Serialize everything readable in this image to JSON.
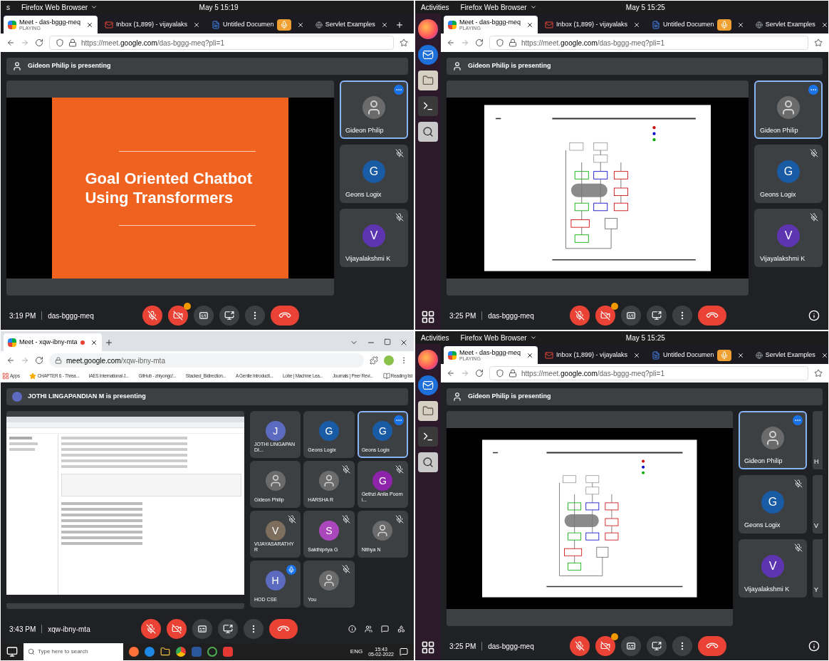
{
  "panels": [
    {
      "kind": "firefox",
      "topbar": {
        "activities": "s",
        "app": "Firefox Web Browser",
        "clock": "May 5  15:19"
      },
      "tabs": [
        {
          "title": "Meet - das-bggg-meq",
          "subtitle": "PLAYING",
          "kind": "meet",
          "sharing": false,
          "selected": true
        },
        {
          "title": "Inbox (1,899) - vijayalaks",
          "kind": "mail",
          "sharing": false,
          "selected": false
        },
        {
          "title": "Untitled Documen",
          "kind": "doc",
          "sharing": true,
          "selected": false
        },
        {
          "title": "Servlet Examples",
          "kind": "page",
          "sharing": false,
          "selected": false
        }
      ],
      "url": {
        "prefix": "https://meet.",
        "domain": "google.com",
        "path": "/das-bggg-meq?pli=1"
      },
      "banner": {
        "text": "Gideon Philip is presenting",
        "kind": "presenter"
      },
      "stage": {
        "kind": "title",
        "lines": [
          "Goal Oriented Chatbot",
          "Using Transformers"
        ]
      },
      "tiles": [
        {
          "name": "Gideon Philip",
          "kind": "photo",
          "selected": true,
          "muted": false,
          "speaking": false
        },
        {
          "name": "Geons Logix",
          "kind": "letter",
          "initial": "G",
          "color": "#1a5ba6",
          "selected": false,
          "muted": true,
          "speaking": false
        },
        {
          "name": "Vijayalakshmi K",
          "kind": "letter",
          "initial": "V",
          "color": "#5e35b1",
          "selected": false,
          "muted": true,
          "speaking": false
        }
      ],
      "bottom": {
        "time": "3:19 PM",
        "code": "das-bggg-meq",
        "controls": [
          {
            "kind": "mic",
            "alert": true,
            "badge": false
          },
          {
            "kind": "camera",
            "alert": true,
            "badge": true
          },
          {
            "kind": "captions",
            "alert": false,
            "badge": false
          },
          {
            "kind": "present",
            "alert": false,
            "badge": false
          },
          {
            "kind": "more",
            "alert": false,
            "badge": false
          },
          {
            "kind": "end",
            "alert": true,
            "badge": false
          }
        ]
      }
    },
    {
      "kind": "firefox",
      "topbar": {
        "activities": "Activities",
        "app": "Firefox Web Browser",
        "clock": "May 5  15:25"
      },
      "dock": [
        {
          "kind": "firefox"
        },
        {
          "kind": "mail"
        },
        {
          "kind": "files"
        },
        {
          "kind": "terminal"
        },
        {
          "kind": "magnifier"
        }
      ],
      "tabs": [
        {
          "title": "Meet - das-bggg-meq",
          "subtitle": "PLAYING",
          "kind": "meet",
          "sharing": false,
          "selected": true
        },
        {
          "title": "Inbox (1,899) - vijayalaks",
          "kind": "mail",
          "sharing": false,
          "selected": false
        },
        {
          "title": "Untitled Documen",
          "kind": "doc",
          "sharing": true,
          "selected": false
        },
        {
          "title": "Servlet Examples",
          "kind": "page",
          "sharing": false,
          "selected": false
        }
      ],
      "url": {
        "prefix": "https://meet.",
        "domain": "google.com",
        "path": "/das-bggg-meq?pli=1"
      },
      "banner": {
        "text": "Gideon Philip is presenting",
        "kind": "presenter"
      },
      "stage": {
        "kind": "diagram",
        "overlay": true
      },
      "tiles": [
        {
          "name": "Gideon Philip",
          "kind": "photo",
          "selected": true,
          "muted": false,
          "speaking": false
        },
        {
          "name": "Geons Logix",
          "kind": "letter",
          "initial": "G",
          "color": "#1a5ba6",
          "selected": false,
          "muted": true,
          "speaking": false
        },
        {
          "name": "Vijayalakshmi K",
          "kind": "letter",
          "initial": "V",
          "color": "#5e35b1",
          "selected": false,
          "muted": true,
          "speaking": false
        }
      ],
      "bottom": {
        "time": "3:25 PM",
        "code": "das-bggg-meq",
        "controls": [
          {
            "kind": "mic",
            "alert": true,
            "badge": false
          },
          {
            "kind": "camera",
            "alert": true,
            "badge": true
          },
          {
            "kind": "captions",
            "alert": false,
            "badge": false
          },
          {
            "kind": "present",
            "alert": false,
            "badge": false
          },
          {
            "kind": "more",
            "alert": false,
            "badge": false
          },
          {
            "kind": "end",
            "alert": true,
            "badge": false
          }
        ],
        "side": [
          {
            "kind": "info"
          }
        ]
      }
    },
    {
      "kind": "chrome",
      "tabs": [
        {
          "title": "Meet - xqw-ibny-mta",
          "kind": "meet",
          "recording": true,
          "selected": true
        }
      ],
      "url": {
        "domain": "meet.google.com",
        "path": "/xqw-ibny-mta"
      },
      "bookmarks": [
        {
          "label": "Apps",
          "kind": "apps"
        },
        {
          "label": "CHAPTER 6 - Threa...",
          "kind": "star"
        },
        {
          "label": "IAES International J...",
          "kind": "page"
        },
        {
          "label": "GitHub - zhiyongc/...",
          "kind": "github"
        },
        {
          "label": "Stacked_Bidirection...",
          "kind": "github"
        },
        {
          "label": "A Gentle Introducti...",
          "kind": "page"
        },
        {
          "label": "Lobe | Machine Lea...",
          "kind": "page"
        },
        {
          "label": "Journals | Peer Revi...",
          "kind": "page"
        },
        {
          "label": "Reading list",
          "kind": "list"
        }
      ],
      "banner": {
        "text": "JOTHI LINGAPANDIAN M is presenting",
        "kind": "avatar"
      },
      "stage": {
        "kind": "screen"
      },
      "tiles": [
        {
          "name": "JOTHI LINGAPANDI...",
          "kind": "letter",
          "initial": "J",
          "color": "#5c6bc0",
          "selected": false,
          "muted": false,
          "speaking": false
        },
        {
          "name": "Geons Logix",
          "kind": "letter",
          "initial": "G",
          "color": "#1a5ba6",
          "selected": false,
          "muted": false,
          "speaking": false
        },
        {
          "name": "Geons Logix",
          "kind": "letter",
          "initial": "G",
          "color": "#1a5ba6",
          "selected": true,
          "muted": false,
          "speaking": false
        },
        {
          "name": "Gideon Philip",
          "kind": "photo",
          "selected": false,
          "muted": false,
          "speaking": false
        },
        {
          "name": "HARSHA R",
          "kind": "photo",
          "selected": false,
          "muted": true,
          "speaking": false
        },
        {
          "name": "Gethzi Anila Poorni...",
          "kind": "letter",
          "initial": "G",
          "color": "#8e24aa",
          "selected": false,
          "muted": true,
          "speaking": false
        },
        {
          "name": "VIJAYASARATHY R",
          "kind": "letter",
          "initial": "V",
          "color": "#7d6e5d",
          "selected": false,
          "muted": true,
          "speaking": false
        },
        {
          "name": "Sakthipriya G",
          "kind": "letter",
          "initial": "S",
          "color": "#ab47bc",
          "selected": false,
          "muted": true,
          "speaking": false
        },
        {
          "name": "Nithya N",
          "kind": "photo",
          "selected": false,
          "muted": true,
          "speaking": false
        },
        {
          "name": "HOD CSE",
          "kind": "letter",
          "initial": "H",
          "color": "#5c6bc0",
          "selected": false,
          "muted": false,
          "speaking": true
        },
        {
          "name": "You",
          "kind": "photo",
          "selected": false,
          "muted": true,
          "speaking": false
        }
      ],
      "bottom": {
        "time": "3:43 PM",
        "code": "xqw-ibny-mta",
        "controls": [
          {
            "kind": "mic",
            "alert": true,
            "badge": false
          },
          {
            "kind": "camera",
            "alert": true,
            "badge": false
          },
          {
            "kind": "captions",
            "alert": false,
            "badge": false
          },
          {
            "kind": "present",
            "alert": false,
            "badge": false
          },
          {
            "kind": "more",
            "alert": false,
            "badge": false
          },
          {
            "kind": "end",
            "alert": true,
            "badge": false
          }
        ],
        "side": [
          {
            "kind": "info"
          },
          {
            "kind": "people"
          },
          {
            "kind": "chat"
          },
          {
            "kind": "activities"
          }
        ]
      },
      "taskbar": {
        "search": "Type here to search",
        "lang": "ENG",
        "time": "15:43",
        "date": "05-02-2022"
      }
    },
    {
      "kind": "firefox",
      "topbar": {
        "activities": "Activities",
        "app": "Firefox Web Browser",
        "clock": "May 5  15:25"
      },
      "dock": [
        {
          "kind": "firefox"
        },
        {
          "kind": "mail"
        },
        {
          "kind": "files"
        },
        {
          "kind": "terminal"
        },
        {
          "kind": "magnifier"
        }
      ],
      "tabs": [
        {
          "title": "Meet - das-bggg-meq",
          "subtitle": "PLAYING",
          "kind": "meet",
          "sharing": false,
          "selected": true
        },
        {
          "title": "Inbox (1,899) - vijayalaks",
          "kind": "mail",
          "sharing": false,
          "selected": false
        },
        {
          "title": "Untitled Documen",
          "kind": "doc",
          "sharing": true,
          "selected": false
        },
        {
          "title": "Servlet Examples",
          "kind": "page",
          "sharing": false,
          "selected": false
        }
      ],
      "url": {
        "prefix": "https://meet.",
        "domain": "google.com",
        "path": "/das-bggg-meq?pli=1"
      },
      "banner": {
        "text": "Gideon Philip is presenting",
        "kind": "presenter"
      },
      "stage": {
        "kind": "diagram",
        "overlay": true
      },
      "tiles": [
        {
          "name": "Gideon Philip",
          "kind": "photo",
          "selected": true,
          "muted": false,
          "speaking": false
        },
        {
          "name": "Geons Logix",
          "kind": "letter",
          "initial": "G",
          "color": "#1a5ba6",
          "selected": false,
          "muted": true,
          "speaking": false
        },
        {
          "name": "Vijayalakshmi K",
          "kind": "letter",
          "initial": "V",
          "color": "#5e35b1",
          "selected": false,
          "muted": true,
          "speaking": false
        }
      ],
      "cut_tiles": [
        "H",
        "V",
        "Y"
      ],
      "bottom": {
        "time": "3:25 PM",
        "code": "das-bggg-meq",
        "controls": [
          {
            "kind": "mic",
            "alert": true,
            "badge": false
          },
          {
            "kind": "camera",
            "alert": true,
            "badge": true
          },
          {
            "kind": "captions",
            "alert": false,
            "badge": false
          },
          {
            "kind": "present",
            "alert": false,
            "badge": false
          },
          {
            "kind": "more",
            "alert": false,
            "badge": false
          },
          {
            "kind": "end",
            "alert": true,
            "badge": false
          }
        ],
        "side": [
          {
            "kind": "info"
          }
        ]
      }
    }
  ]
}
